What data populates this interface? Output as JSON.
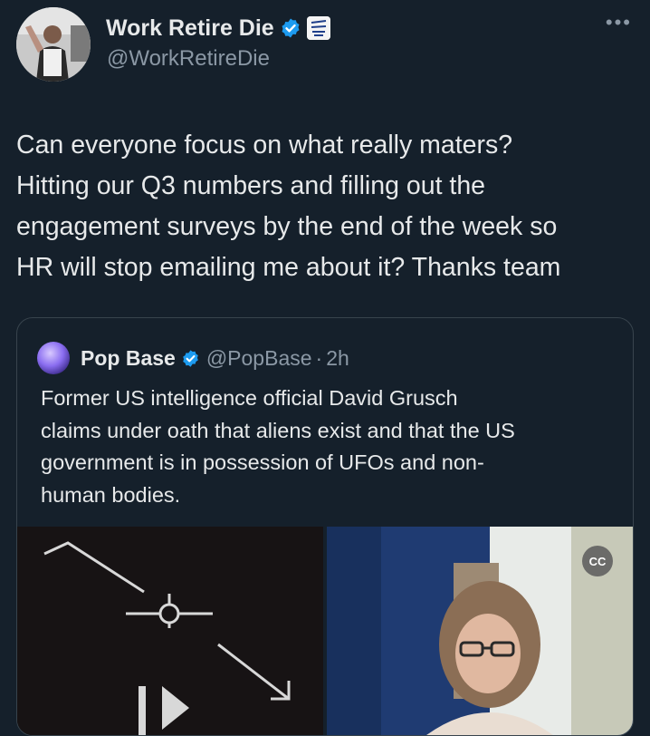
{
  "author": {
    "display_name": "Work Retire Die",
    "handle": "@WorkRetireDie",
    "avatar_icon": "person-photo",
    "verified_icon": "verified-badge-icon",
    "affiliate_icon": "affiliate-badge-icon"
  },
  "more_icon": "more-options-icon",
  "tweet": {
    "lines": [
      "Can everyone focus on what really maters?",
      "Hitting our Q3 numbers and filling out the",
      "engagement surveys by the end of the week so",
      "HR will stop emailing me about it? Thanks team"
    ]
  },
  "quote": {
    "display_name": "Pop Base",
    "handle": "@PopBase",
    "dot": "·",
    "time": "2h",
    "lines": [
      "Former US intelligence official David Grusch",
      "claims under oath that aliens exist and that the US",
      "government is in possession of UFOs and non-",
      "human bodies."
    ]
  },
  "media": {
    "left_icon": "ufo-footage-image",
    "right_icon": "hearing-photo-image",
    "captions_icon": "captions-icon"
  },
  "colors": {
    "background": "#15202b",
    "text": "#e7e9ea",
    "secondary": "#8b98a5",
    "verified": "#1d9bf0",
    "border": "#38444d"
  }
}
